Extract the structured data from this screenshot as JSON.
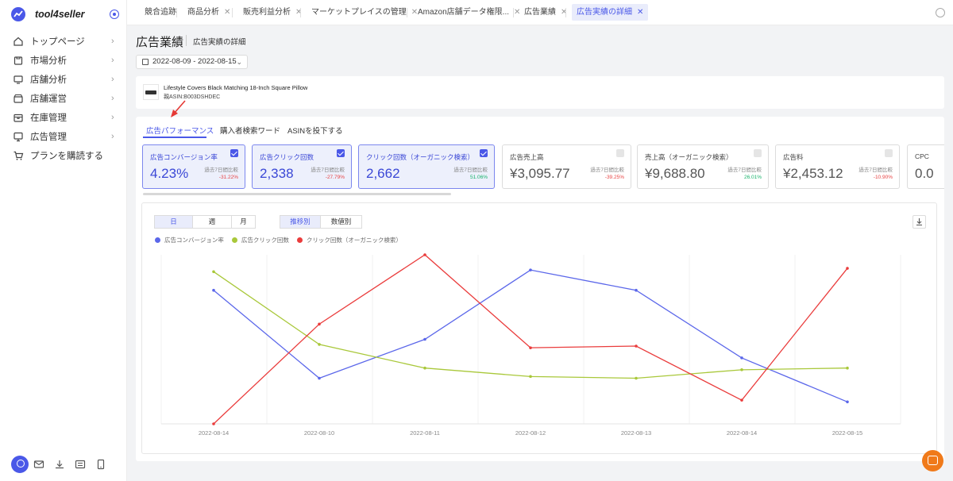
{
  "app": {
    "brand": "tool4seller"
  },
  "sidebar": {
    "items": [
      {
        "label": "トップページ",
        "icon": "home-icon"
      },
      {
        "label": "市場分析",
        "icon": "market-icon"
      },
      {
        "label": "店舗分析",
        "icon": "store-analysis-icon"
      },
      {
        "label": "店舗運営",
        "icon": "store-ops-icon"
      },
      {
        "label": "在庫管理",
        "icon": "inventory-icon"
      },
      {
        "label": "広告管理",
        "icon": "ads-icon"
      },
      {
        "label": "プランを購読する",
        "icon": "cart-icon"
      }
    ]
  },
  "tabs": [
    {
      "label": "競合追跡",
      "closable": false
    },
    {
      "label": "商品分析",
      "closable": true
    },
    {
      "label": "販売利益分析",
      "closable": true
    },
    {
      "label": "マーケットプレイスの管理",
      "closable": true
    },
    {
      "label": "Amazon店舗データ権限...",
      "closable": true
    },
    {
      "label": "広告業績",
      "closable": true
    },
    {
      "label": "広告実績の詳細",
      "closable": true,
      "active": true
    }
  ],
  "header": {
    "title": "広告業績",
    "breadcrumb": "広告実績の詳細",
    "date_range": "2022-08-09 - 2022-08-15"
  },
  "product": {
    "name": "Lifestyle Covers Black Matching 18-Inch Square Pillow",
    "asin": "親ASIN:B003DSHDEC"
  },
  "subtabs": [
    "広告パフォーマンス",
    "購入者検索ワード",
    "ASINを投下する"
  ],
  "kpis": [
    {
      "title": "広告コンバージョン率",
      "value": "4.23%",
      "compare_label": "過去7日間比較",
      "change": "-31.22%",
      "trend": "neg",
      "checked": true
    },
    {
      "title": "広告クリック回数",
      "value": "2,338",
      "compare_label": "過去7日間比較",
      "change": "-27.79%",
      "trend": "neg",
      "checked": true
    },
    {
      "title": "クリック回数（オーガニック検索）",
      "value": "2,662",
      "compare_label": "過去7日間比較",
      "change": "51.06%",
      "trend": "pos",
      "checked": true
    },
    {
      "title": "広告売上高",
      "value": "¥3,095.77",
      "compare_label": "過去7日間比較",
      "change": "-39.25%",
      "trend": "neg",
      "checked": false
    },
    {
      "title": "売上高（オーガニック検索）",
      "value": "¥9,688.80",
      "compare_label": "過去7日間比較",
      "change": "26.01%",
      "trend": "pos",
      "checked": false
    },
    {
      "title": "広告料",
      "value": "¥2,453.12",
      "compare_label": "過去7日間比較",
      "change": "-10.90%",
      "trend": "neg",
      "checked": false
    },
    {
      "title": "CPC",
      "value": "0.0",
      "compare_label": "",
      "change": "",
      "trend": "",
      "checked": false
    }
  ],
  "chart_controls": {
    "period": [
      "日",
      "週",
      "月"
    ],
    "period_active": 0,
    "mode": [
      "推移別",
      "数値別"
    ],
    "mode_active": 0
  },
  "colors": {
    "accent": "#4a58e8",
    "blue": "#5b67ea",
    "green": "#a9c83a",
    "red": "#ea3c3c",
    "orange": "#f07a1a"
  },
  "chart_data": {
    "type": "line",
    "categories": [
      "2022-08-14",
      "2022-08-10",
      "2022-08-11",
      "2022-08-12",
      "2022-08-13",
      "2022-08-14",
      "2022-08-15"
    ],
    "series": [
      {
        "name": "広告コンバージョン率",
        "color": "#5b67ea",
        "values": [
          0.79,
          0.27,
          0.5,
          0.91,
          0.79,
          0.39,
          0.13
        ]
      },
      {
        "name": "広告クリック回数",
        "color": "#a9c83a",
        "values": [
          0.9,
          0.47,
          0.33,
          0.28,
          0.27,
          0.32,
          0.33
        ]
      },
      {
        "name": "クリック回数（オーガニック検索）",
        "color": "#ea3c3c",
        "values": [
          0.0,
          0.59,
          1.0,
          0.45,
          0.46,
          0.14,
          0.92
        ]
      }
    ],
    "ylim": [
      0,
      1
    ],
    "grid": true,
    "legend": "top-left"
  }
}
